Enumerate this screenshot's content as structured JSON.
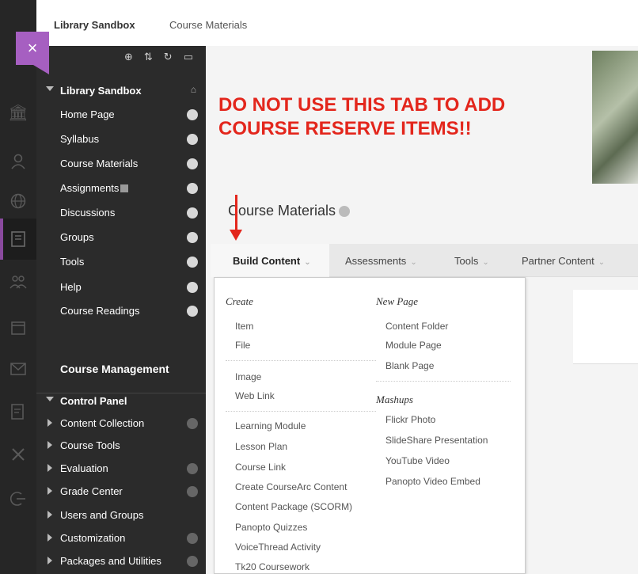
{
  "breadcrumb": {
    "course": "Library Sandbox",
    "page": "Course Materials"
  },
  "close_symbol": "×",
  "left_strip_icons": [
    "institution-icon",
    "person-icon",
    "globe-icon",
    "courses-icon",
    "groups-icon",
    "calendar-icon",
    "mail-icon",
    "grades-icon",
    "tools-icon",
    "logout-icon"
  ],
  "menu": {
    "tool_icons": [
      "add-icon",
      "sort-icon",
      "refresh-icon",
      "folder-icon"
    ],
    "course_title": "Library Sandbox",
    "items": [
      {
        "label": "Home Page"
      },
      {
        "label": "Syllabus"
      },
      {
        "label": "Course Materials"
      },
      {
        "label": "Assignments"
      },
      {
        "label": "Discussions"
      },
      {
        "label": "Groups"
      },
      {
        "label": "Tools"
      },
      {
        "label": "Help"
      },
      {
        "label": "Course Readings"
      }
    ],
    "management_title": "Course Management",
    "control_panel": "Control Panel",
    "control_items": [
      {
        "label": "Content Collection",
        "dot": true
      },
      {
        "label": "Course Tools",
        "dot": false
      },
      {
        "label": "Evaluation",
        "dot": true
      },
      {
        "label": "Grade Center",
        "dot": true
      },
      {
        "label": "Users and Groups",
        "dot": false
      },
      {
        "label": "Customization",
        "dot": true
      },
      {
        "label": "Packages and Utilities",
        "dot": true
      }
    ]
  },
  "warning_text": "DO NOT USE THIS TAB TO ADD COURSE RESERVE ITEMS!!",
  "page_title": "Course Materials",
  "action_bar": {
    "tabs": [
      "Build Content",
      "Assessments",
      "Tools",
      "Partner Content"
    ]
  },
  "dropdown": {
    "create_head": "Create",
    "create_items": [
      "Item",
      "File"
    ],
    "create_items2": [
      "Image",
      "Web Link"
    ],
    "create_items3": [
      "Learning Module",
      "Lesson Plan",
      "Course Link",
      "Create CourseArc Content",
      "Content Package (SCORM)",
      "Panopto Quizzes",
      "VoiceThread Activity",
      "Tk20 Coursework"
    ],
    "newpage_head": "New Page",
    "newpage_items": [
      "Content Folder",
      "Module Page",
      "Blank Page"
    ],
    "mashups_head": "Mashups",
    "mashups_items": [
      "Flickr Photo",
      "SlideShare Presentation",
      "YouTube Video",
      "Panopto Video Embed"
    ]
  }
}
